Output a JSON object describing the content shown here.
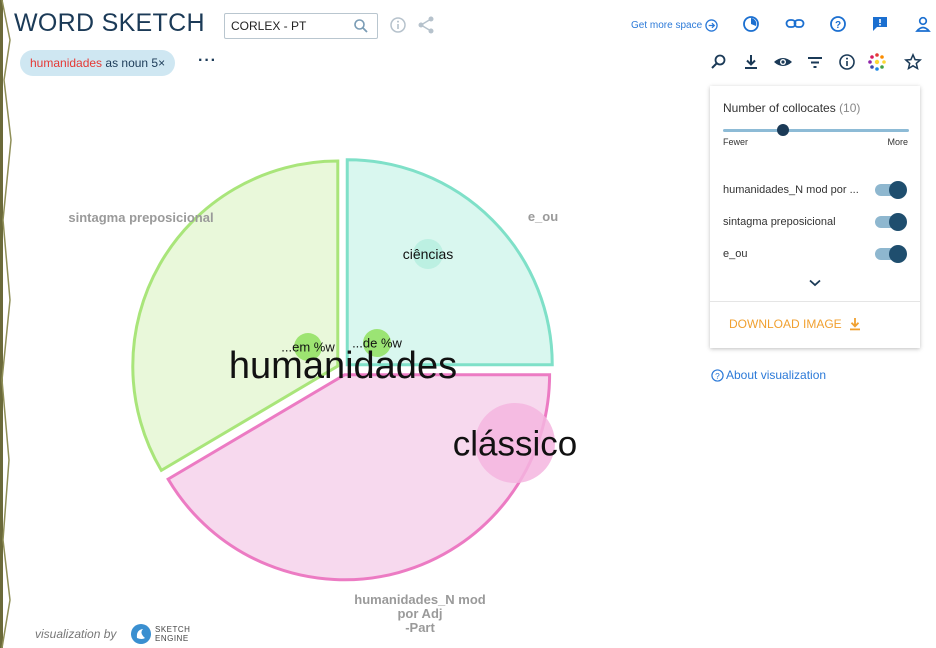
{
  "app_title": "WORD SKETCH",
  "corpus": {
    "value": "CORLEX - PT"
  },
  "header": {
    "more_space": "Get more space"
  },
  "query_chip": {
    "word": "humanidades",
    "rest": " as noun 5×"
  },
  "more_options": "···",
  "panel": {
    "collocates_label": "Number of collocates",
    "collocates_count": "(10)",
    "slider_fraction": 0.32,
    "fewer": "Fewer",
    "more": "More",
    "relations": [
      {
        "label": "humanidades_N mod por ...",
        "enabled": true
      },
      {
        "label": "sintagma preposicional",
        "enabled": true
      },
      {
        "label": "e_ou",
        "enabled": true
      }
    ],
    "download": "DOWNLOAD IMAGE"
  },
  "about": "About visualization",
  "footer": {
    "viz_by": "visualization by",
    "logo_top": "SKETCH",
    "logo_bottom": "ENGINE"
  },
  "icons": {
    "search": "search-icon",
    "info": "info-icon",
    "share": "share-icon",
    "arrow_right": "arrow-right-circle-icon",
    "history": "history-icon",
    "link": "link-icon",
    "help": "help-icon",
    "feedback": "feedback-icon",
    "user": "user-icon",
    "zoom": "zoom-icon",
    "download": "download-icon",
    "eye": "eye-icon",
    "filter": "filter-icon",
    "colors": "color-palette-icon",
    "star": "star-icon",
    "chevron": "chevron-down-icon"
  },
  "colors": {
    "title": "#1b3a57",
    "chip_bg": "#cfe7f2",
    "accent_blue": "#2c7ad8",
    "download_orange": "#f0a030",
    "pie_green": "#e9f8da",
    "pie_green_stroke": "#a9e57a",
    "pie_mint": "#d9f7ef",
    "pie_mint_stroke": "#7fe0c8",
    "pie_pink": "#f7d9ee",
    "pie_pink_stroke": "#ec7bc3"
  },
  "chart_data": {
    "type": "pie",
    "center_word": "humanidades",
    "slices": [
      {
        "name": "e_ou",
        "share": 0.25
      },
      {
        "name": "humanidades_N mod por Adj -Part",
        "share": 0.415
      },
      {
        "name": "sintagma preposicional",
        "share": 0.335
      }
    ],
    "slice_labels": [
      {
        "lines": [
          "e_ou"
        ]
      },
      {
        "lines": [
          "humanidades_N mod",
          "por Adj",
          "-Part"
        ]
      },
      {
        "lines": [
          "sintagma preposicional"
        ]
      }
    ],
    "collocates": [
      {
        "word": "ciências",
        "relation": "e_ou"
      },
      {
        "word": "clássico",
        "relation": "humanidades_N mod por Adj -Part"
      },
      {
        "word": "...em %w",
        "relation": "sintagma preposicional"
      },
      {
        "word": "...de %w",
        "relation": "e_ou"
      }
    ]
  }
}
